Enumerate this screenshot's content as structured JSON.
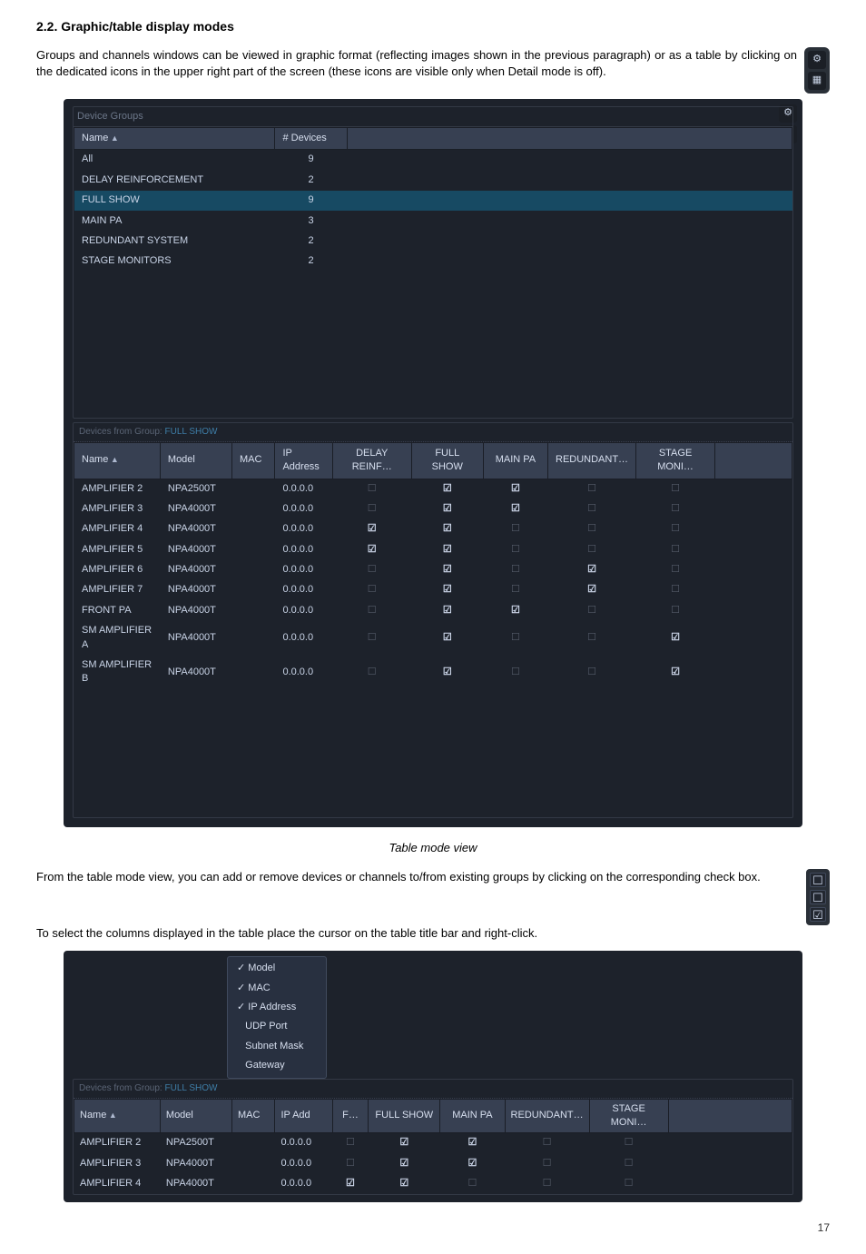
{
  "section_heading": "2.2. Graphic/table display modes",
  "para1": "Groups and channels windows can be viewed in graphic format (reflecting images shown in the previous paragraph) or as a table by clicking on the dedicated icons in the upper right part of the screen (these icons are visible only when Detail mode is off).",
  "groups_panel": {
    "title": "Device Groups",
    "columns": {
      "name": "Name",
      "devices": "# Devices"
    },
    "rows": [
      {
        "name": "All",
        "devices": "9",
        "selected": false
      },
      {
        "name": "DELAY REINFORCEMENT",
        "devices": "2",
        "selected": false
      },
      {
        "name": "FULL SHOW",
        "devices": "9",
        "selected": true
      },
      {
        "name": "MAIN PA",
        "devices": "3",
        "selected": false
      },
      {
        "name": "REDUNDANT SYSTEM",
        "devices": "2",
        "selected": false
      },
      {
        "name": "STAGE MONITORS",
        "devices": "2",
        "selected": false
      }
    ]
  },
  "devices_panel": {
    "title_prefix": "Devices from Group:",
    "group_name": "FULL SHOW",
    "columns": {
      "name": "Name",
      "model": "Model",
      "mac": "MAC",
      "ip": "IP Address",
      "delay": "DELAY REINF…",
      "full": "FULL SHOW",
      "main": "MAIN PA",
      "redund": "REDUNDANT…",
      "stage": "STAGE MONI…"
    },
    "rows": [
      {
        "name": "AMPLIFIER 2",
        "model": "NPA2500T",
        "mac": "",
        "ip": "0.0.0.0",
        "delay": false,
        "full": true,
        "main": true,
        "redund": false,
        "stage": false
      },
      {
        "name": "AMPLIFIER 3",
        "model": "NPA4000T",
        "mac": "",
        "ip": "0.0.0.0",
        "delay": false,
        "full": true,
        "main": true,
        "redund": false,
        "stage": false
      },
      {
        "name": "AMPLIFIER 4",
        "model": "NPA4000T",
        "mac": "",
        "ip": "0.0.0.0",
        "delay": true,
        "full": true,
        "main": false,
        "redund": false,
        "stage": false
      },
      {
        "name": "AMPLIFIER 5",
        "model": "NPA4000T",
        "mac": "",
        "ip": "0.0.0.0",
        "delay": true,
        "full": true,
        "main": false,
        "redund": false,
        "stage": false
      },
      {
        "name": "AMPLIFIER 6",
        "model": "NPA4000T",
        "mac": "",
        "ip": "0.0.0.0",
        "delay": false,
        "full": true,
        "main": false,
        "redund": true,
        "stage": false
      },
      {
        "name": "AMPLIFIER 7",
        "model": "NPA4000T",
        "mac": "",
        "ip": "0.0.0.0",
        "delay": false,
        "full": true,
        "main": false,
        "redund": true,
        "stage": false
      },
      {
        "name": "FRONT PA",
        "model": "NPA4000T",
        "mac": "",
        "ip": "0.0.0.0",
        "delay": false,
        "full": true,
        "main": true,
        "redund": false,
        "stage": false
      },
      {
        "name": "SM AMPLIFIER A",
        "model": "NPA4000T",
        "mac": "",
        "ip": "0.0.0.0",
        "delay": false,
        "full": true,
        "main": false,
        "redund": false,
        "stage": true
      },
      {
        "name": "SM AMPLIFIER B",
        "model": "NPA4000T",
        "mac": "",
        "ip": "0.0.0.0",
        "delay": false,
        "full": true,
        "main": false,
        "redund": false,
        "stage": true
      }
    ]
  },
  "caption1": "Table mode view",
  "para2": "From the table mode view, you can add or remove devices or channels to/from existing groups by clicking on the corresponding check box.",
  "para3": "To select the columns displayed in the table place the cursor on the table title bar and right-click.",
  "context_menu": {
    "items": [
      {
        "label": "Model",
        "checked": true
      },
      {
        "label": "MAC",
        "checked": true
      },
      {
        "label": "IP Address",
        "checked": true
      },
      {
        "label": "UDP Port",
        "checked": false
      },
      {
        "label": "Subnet Mask",
        "checked": false
      },
      {
        "label": "Gateway",
        "checked": false
      }
    ]
  },
  "ctx_devices": {
    "title_prefix": "Devices from Group:",
    "group_name": "FULL SHOW",
    "columns": {
      "name": "Name",
      "model": "Model",
      "mac": "MAC",
      "ip": "IP Add",
      "f": "F…",
      "full": "FULL SHOW",
      "main": "MAIN PA",
      "redund": "REDUNDANT…",
      "stage": "STAGE MONI…"
    },
    "rows": [
      {
        "name": "AMPLIFIER 2",
        "model": "NPA2500T",
        "mac": "",
        "ip": "0.0.0.0",
        "f": false,
        "full": true,
        "main": true,
        "redund": false,
        "stage": false
      },
      {
        "name": "AMPLIFIER 3",
        "model": "NPA4000T",
        "mac": "",
        "ip": "0.0.0.0",
        "f": false,
        "full": true,
        "main": true,
        "redund": false,
        "stage": false
      },
      {
        "name": "AMPLIFIER 4",
        "model": "NPA4000T",
        "mac": "",
        "ip": "0.0.0.0",
        "f": true,
        "full": true,
        "main": false,
        "redund": false,
        "stage": false
      }
    ]
  },
  "pagenum": "17"
}
